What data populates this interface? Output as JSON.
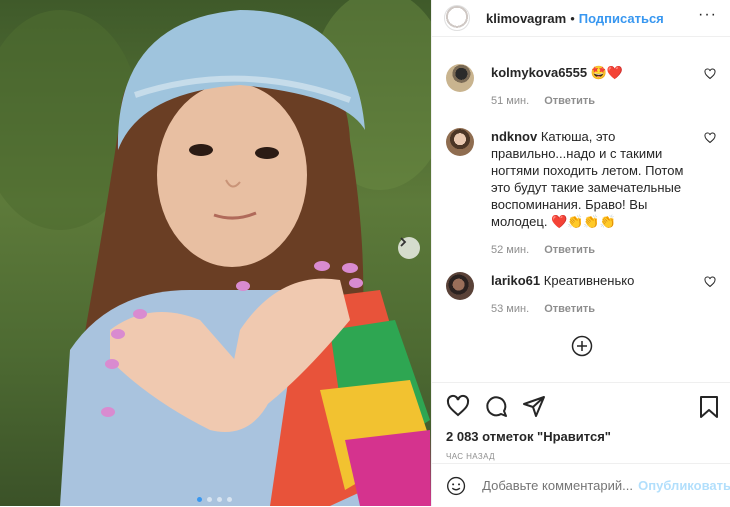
{
  "post": {
    "author": "klimovagram",
    "separator": "•",
    "follow_label": "Подписаться",
    "more_label": "···"
  },
  "comments": [
    {
      "user": "kolmykova6555",
      "text": "🤩❤️",
      "time": "51 мин.",
      "reply": "Ответить"
    },
    {
      "user": "ndknov",
      "text": "Катюша, это правильно...надо и с такими ногтями походить летом. Потом это будут такие замечательные воспоминания. Браво! Вы молодец. ❤️👏👏👏",
      "time": "52 мин.",
      "reply": "Ответить"
    },
    {
      "user": "lariko61",
      "text": "Креативненько",
      "time": "53 мин.",
      "reply": "Ответить"
    }
  ],
  "likes_text": "2 083 отметок \"Нравится\"",
  "time_ago": "ЧАС НАЗАД",
  "add_comment_placeholder": "Добавьте комментарий...",
  "publish_label": "Опубликовать",
  "carousel": {
    "slides": 4,
    "active_index": 0
  },
  "colors": {
    "accent": "#3897f0",
    "publish_disabled": "#b2dffc",
    "meta": "#8e8e8e"
  }
}
